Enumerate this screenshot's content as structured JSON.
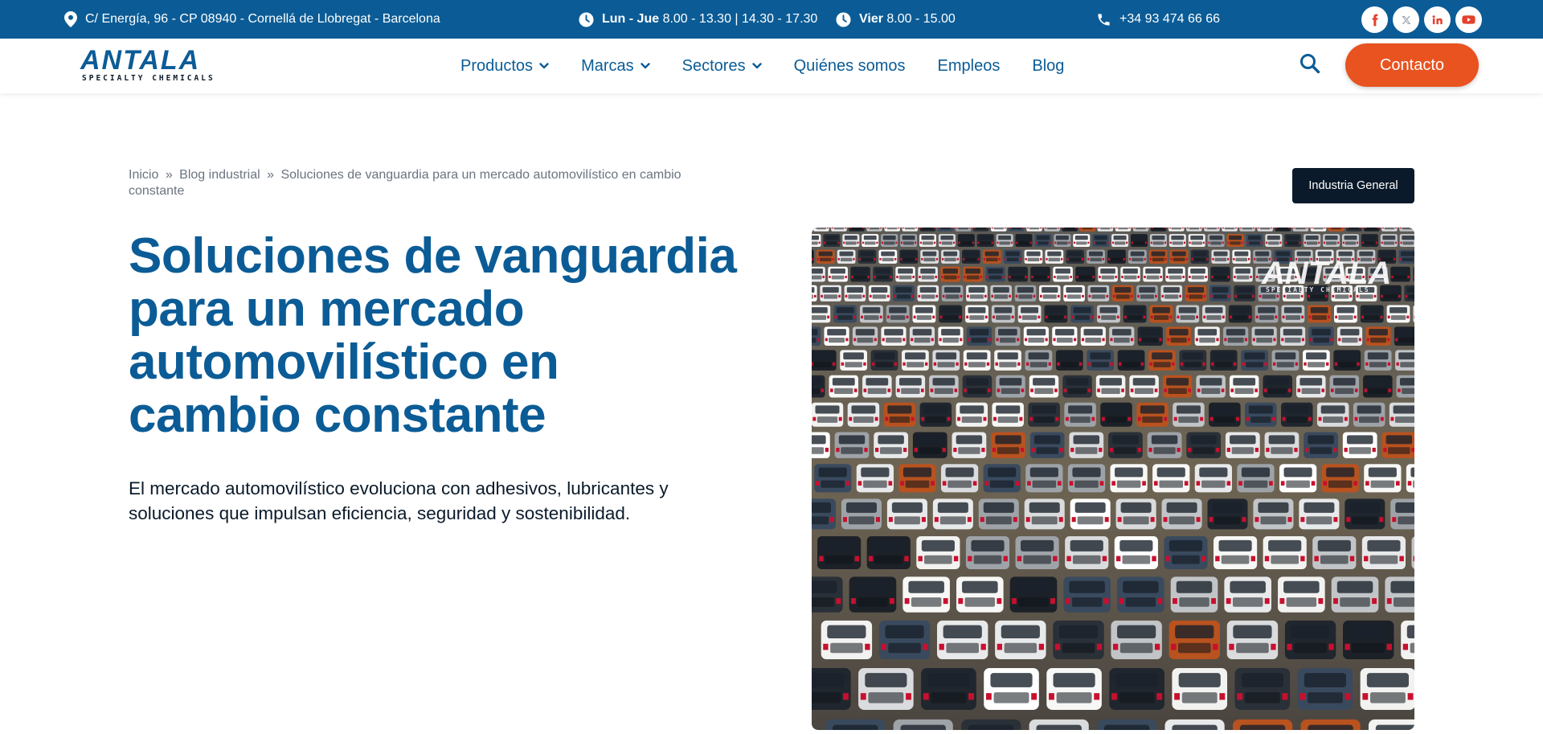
{
  "topbar": {
    "address": "C/ Energía, 96 - CP 08940 - Cornellá de Llobregat - Barcelona",
    "hours1_days": "Lun - Jue",
    "hours1_time": "8.00 - 13.30 | 14.30 - 17.30",
    "hours2_days": "Vier",
    "hours2_time": "8.00 - 15.00",
    "phone": "+34 93 474 66 66",
    "socials": [
      "facebook-icon",
      "x-twitter-icon",
      "linkedin-icon",
      "youtube-icon"
    ]
  },
  "header": {
    "logo_main": "ANTALA",
    "logo_sub": "SPECIALTY CHEMICALS",
    "nav": [
      {
        "label": "Productos",
        "has_dropdown": true
      },
      {
        "label": "Marcas",
        "has_dropdown": true
      },
      {
        "label": "Sectores",
        "has_dropdown": true
      },
      {
        "label": "Quiénes somos",
        "has_dropdown": false
      },
      {
        "label": "Empleos",
        "has_dropdown": false
      },
      {
        "label": "Blog",
        "has_dropdown": false
      }
    ],
    "contact_label": "Contacto"
  },
  "breadcrumb": {
    "home": "Inicio",
    "separator": "»",
    "section": "Blog industrial",
    "current": "Soluciones de vanguardia para un mercado automovilístico en cambio constante"
  },
  "category_badge": "Industria General",
  "article": {
    "title": "Soluciones de vanguardia para un mercado automovilístico en cambio constante",
    "lead": "El mercado automovilístico evoluciona con adhesivos, lubricantes y soluciones que impulsan eficiencia, seguridad y sostenibilidad."
  },
  "hero_image": {
    "watermark_main": "ANTALA",
    "watermark_sub": "SPECIALTY CHEMICALS"
  },
  "colors": {
    "brand_blue": "#0b5c96",
    "accent_orange": "#e85320",
    "dark": "#0a1a2a"
  }
}
